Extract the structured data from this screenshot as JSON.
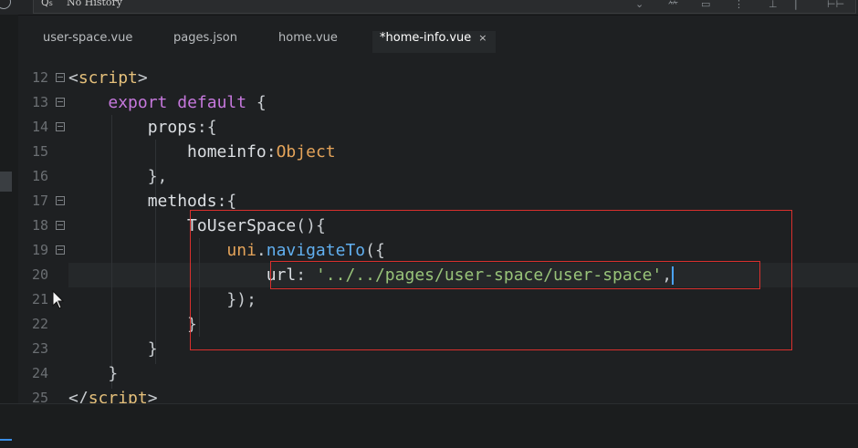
{
  "toolbar": {
    "search_placeholder": "No History",
    "icons": [
      "back-icon",
      "pin-icon",
      "print-icon",
      "more-icon",
      "minimize-icon",
      "window-controls-icon"
    ]
  },
  "tabs": [
    {
      "label": "user-space.vue",
      "active": false
    },
    {
      "label": "pages.json",
      "active": false
    },
    {
      "label": "home.vue",
      "active": false
    },
    {
      "label": "*home-info.vue",
      "active": true
    }
  ],
  "tab_close_glyph": "×",
  "editor": {
    "current_line": 20,
    "line_numbers": [
      "12",
      "13",
      "14",
      "15",
      "16",
      "17",
      "18",
      "19",
      "20",
      "21",
      "22",
      "23",
      "24",
      "25"
    ],
    "lines": [
      [
        {
          "t": "<",
          "c": "punct"
        },
        {
          "t": "script",
          "c": "tag"
        },
        {
          "t": ">",
          "c": "punct"
        }
      ],
      [
        {
          "t": "    ",
          "c": "plain"
        },
        {
          "t": "export",
          "c": "kw"
        },
        {
          "t": " ",
          "c": "plain"
        },
        {
          "t": "default",
          "c": "kw"
        },
        {
          "t": " {",
          "c": "punct"
        }
      ],
      [
        {
          "t": "        ",
          "c": "plain"
        },
        {
          "t": "props",
          "c": "plain"
        },
        {
          "t": ":{",
          "c": "punct"
        }
      ],
      [
        {
          "t": "            ",
          "c": "plain"
        },
        {
          "t": "homeinfo",
          "c": "plain"
        },
        {
          "t": ":",
          "c": "punct"
        },
        {
          "t": "Object",
          "c": "type"
        }
      ],
      [
        {
          "t": "        ",
          "c": "plain"
        },
        {
          "t": "},",
          "c": "punct"
        }
      ],
      [
        {
          "t": "        ",
          "c": "plain"
        },
        {
          "t": "methods",
          "c": "plain"
        },
        {
          "t": ":{",
          "c": "punct"
        }
      ],
      [
        {
          "t": "            ",
          "c": "plain"
        },
        {
          "t": "ToUserSpace",
          "c": "plain"
        },
        {
          "t": "(){",
          "c": "punct"
        }
      ],
      [
        {
          "t": "                ",
          "c": "plain"
        },
        {
          "t": "uni",
          "c": "type"
        },
        {
          "t": ".",
          "c": "punct"
        },
        {
          "t": "navigateTo",
          "c": "fn"
        },
        {
          "t": "({",
          "c": "punct"
        }
      ],
      [
        {
          "t": "                    ",
          "c": "plain"
        },
        {
          "t": "url",
          "c": "plain"
        },
        {
          "t": ": ",
          "c": "punct"
        },
        {
          "t": "'../../pages/user-space/user-space'",
          "c": "str"
        },
        {
          "t": ",",
          "c": "punct"
        }
      ],
      [
        {
          "t": "                ",
          "c": "plain"
        },
        {
          "t": "});",
          "c": "punct"
        }
      ],
      [
        {
          "t": "            ",
          "c": "plain"
        },
        {
          "t": "}",
          "c": "punct"
        }
      ],
      [
        {
          "t": "        ",
          "c": "plain"
        },
        {
          "t": "}",
          "c": "punct"
        }
      ],
      [
        {
          "t": "    ",
          "c": "plain"
        },
        {
          "t": "}",
          "c": "punct"
        }
      ],
      [
        {
          "t": "</",
          "c": "punct"
        },
        {
          "t": "script",
          "c": "tag"
        },
        {
          "t": ">",
          "c": "punct"
        }
      ]
    ],
    "foldable_lines": [
      "12",
      "13",
      "14",
      "17",
      "18",
      "19"
    ]
  },
  "colors": {
    "background": "#1e2022",
    "highlight_box": "#d9302d",
    "caret": "#4aa3ff"
  }
}
